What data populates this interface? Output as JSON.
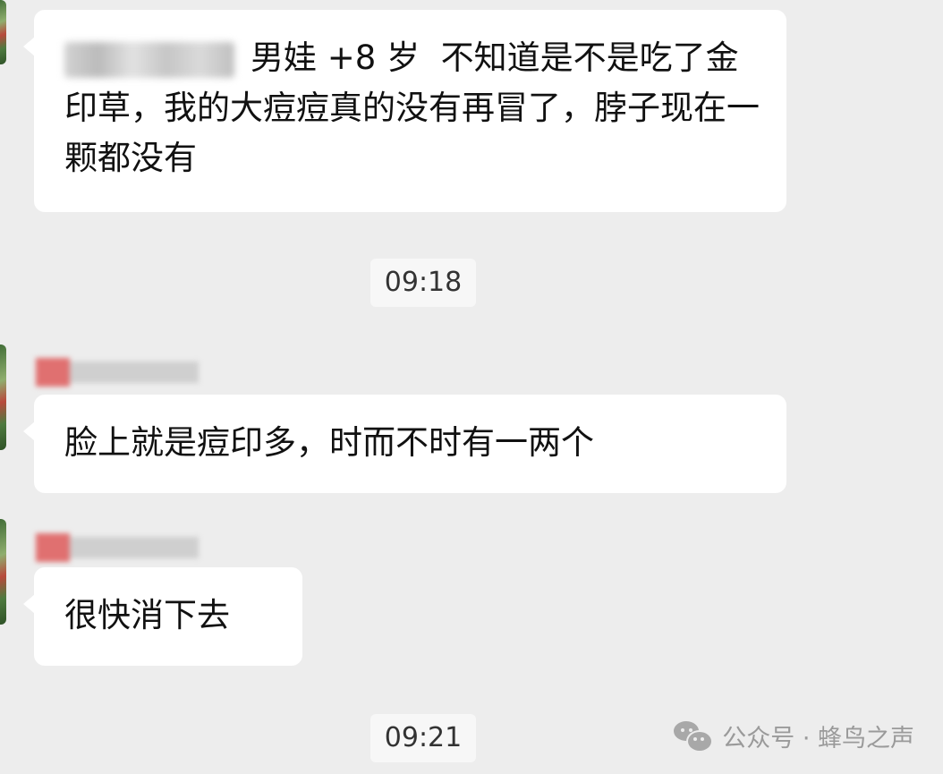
{
  "messages": [
    {
      "text": "男娃 +8 岁  不知道是不是吃了金印草，我的大痘痘真的没有再冒了，脖子现在一颗都没有"
    },
    {
      "text": "脸上就是痘印多，时而不时有一两个"
    },
    {
      "text": "很快消下去"
    }
  ],
  "timestamps": [
    "09:18",
    "09:21"
  ],
  "watermark": {
    "text": "公众号 · 蜂鸟之声",
    "icon": "wechat-icon"
  },
  "colors": {
    "background": "#ededed",
    "bubble": "#ffffff",
    "text": "#111111",
    "timestamp_bg": "#f7f7f7",
    "watermark": "#9a9a9a"
  }
}
